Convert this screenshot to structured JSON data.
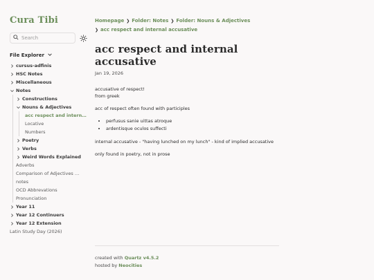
{
  "site": {
    "title": "Cura Tibi"
  },
  "search": {
    "placeholder": "Search"
  },
  "explorer": {
    "title": "File Explorer",
    "items": [
      {
        "label": "cursus-adfinis"
      },
      {
        "label": "HSC Notes"
      },
      {
        "label": "Miscellaneous"
      },
      {
        "label": "Notes"
      },
      {
        "label": "Constructions"
      },
      {
        "label": "Nouns & Adjectives"
      },
      {
        "label": "acc respect and internal accusative"
      },
      {
        "label": "Locative"
      },
      {
        "label": "Numbers"
      },
      {
        "label": "Poetry"
      },
      {
        "label": "Verbs"
      },
      {
        "label": "Weird Words Explained"
      },
      {
        "label": "Adverbs"
      },
      {
        "label": "Comparison of Adjectives and Adverbs"
      },
      {
        "label": "notes"
      },
      {
        "label": "OCD Abbrevations"
      },
      {
        "label": "Pronunciation"
      },
      {
        "label": "Year 11"
      },
      {
        "label": "Year 12 Continuers"
      },
      {
        "label": "Year 12 Extension"
      },
      {
        "label": "Latin Study Day (2026)"
      }
    ]
  },
  "breadcrumb": [
    "Homepage",
    "Folder: Notes",
    "Folder: Nouns & Adjectives",
    "acc respect and internal accusative"
  ],
  "page": {
    "title": "acc respect and internal accusative",
    "date": "Jan 19, 2026",
    "line1": "accusative of respect!",
    "line2": "from greek",
    "para2": "acc of respect often found with participles",
    "bullets": [
      "perfusus sanie uittas atroque",
      "ardentisque oculos suffecti"
    ],
    "para3": "internal accusative - \"having lunched on my lunch\" - kind of implied accusative",
    "para4": "only found in poetry, not in prose"
  },
  "footer": {
    "created_prefix": "created with",
    "created_link": "Quartz v4.5.2",
    "hosted_prefix": "hosted by",
    "hosted_link": "Neocities"
  },
  "colors": {
    "accent": "#6b8e5a",
    "background": "#faf8f8",
    "text": "#2b2b2b"
  }
}
